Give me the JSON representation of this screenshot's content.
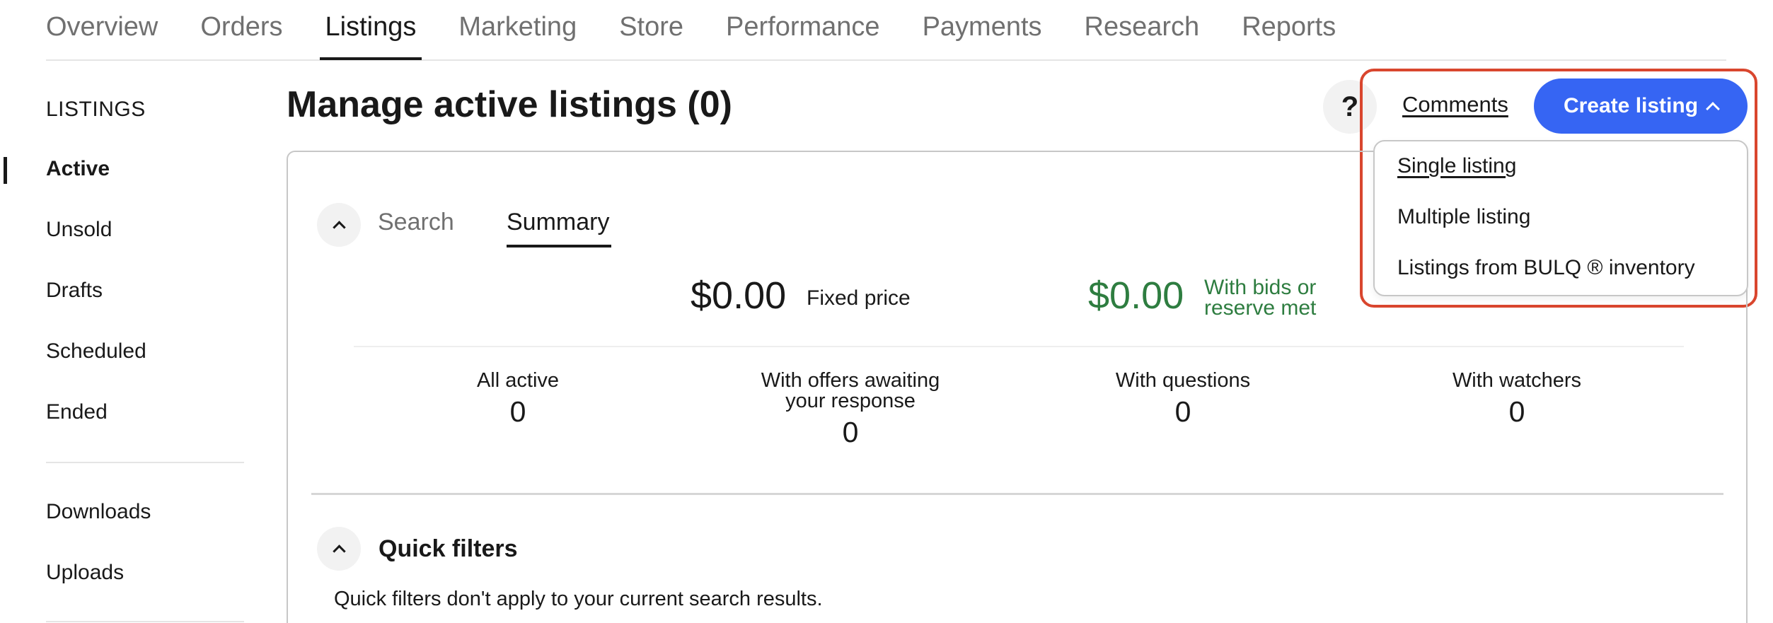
{
  "topnav": {
    "tabs": [
      {
        "label": "Overview"
      },
      {
        "label": "Orders"
      },
      {
        "label": "Listings"
      },
      {
        "label": "Marketing"
      },
      {
        "label": "Store"
      },
      {
        "label": "Performance"
      },
      {
        "label": "Payments"
      },
      {
        "label": "Research"
      },
      {
        "label": "Reports"
      }
    ],
    "active": "Listings"
  },
  "sidebar": {
    "heading": "LISTINGS",
    "items": [
      {
        "label": "Active"
      },
      {
        "label": "Unsold"
      },
      {
        "label": "Drafts"
      },
      {
        "label": "Scheduled"
      },
      {
        "label": "Ended"
      },
      {
        "label": "Downloads"
      },
      {
        "label": "Uploads"
      }
    ]
  },
  "header": {
    "title": "Manage active listings (0)",
    "help_label": "?",
    "comments_label": "Comments",
    "create_label": "Create listing"
  },
  "dropdown": {
    "options": [
      {
        "label": "Single listing"
      },
      {
        "label": "Multiple listing"
      },
      {
        "label": "Listings from BULQ ® inventory"
      }
    ]
  },
  "panel": {
    "tabs": [
      {
        "label": "Search"
      },
      {
        "label": "Summary"
      }
    ],
    "active_tab": "Summary",
    "amounts": [
      {
        "value": "$0.00",
        "label": "Fixed price"
      },
      {
        "value": "$0.00",
        "label_line1": "With bids or",
        "label_line2": "reserve met"
      }
    ],
    "stats": [
      {
        "label": "All active",
        "value": "0"
      },
      {
        "label_line1": "With offers awaiting",
        "label_line2": "your response",
        "value": "0"
      },
      {
        "label": "With questions",
        "value": "0"
      },
      {
        "label": "With watchers",
        "value": "0"
      }
    ],
    "quick_filters": {
      "title": "Quick filters",
      "note": "Quick filters don't apply to your current search results."
    }
  },
  "colors": {
    "primary": "#3665f3",
    "highlight": "#d9462e",
    "positive": "#2e7d40"
  }
}
